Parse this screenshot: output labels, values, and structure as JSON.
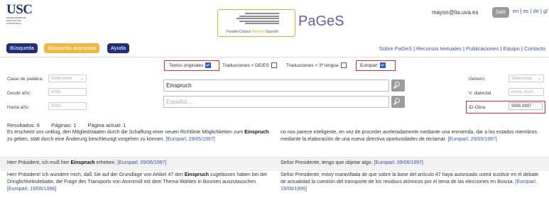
{
  "header": {
    "usc_logo": "USC",
    "usc_logo_sub": "UNIVERSIDADE DE SANTIAGO DE COMPOSTELA",
    "pages_logo": "PaGeS",
    "pages_tagline_1": "Parallel Corpus ",
    "pages_tagline_2": "German",
    "pages_tagline_3": " Spanish",
    "user_email": "maysn@lia.uva.es",
    "logout": "Salir",
    "languages": [
      "en",
      "es",
      "de",
      "gl"
    ]
  },
  "nav": {
    "busqueda": "Búsqueda",
    "busqueda_avanzada": "Búsqueda avanzada",
    "ayuda": "Ayuda",
    "links": [
      "Sobre PaGeS",
      "Recursos textuales",
      "Publicaciones",
      "Equipo",
      "Contacto"
    ]
  },
  "filters": {
    "textos_originales": "Textos originales",
    "traducciones_de_es": "Traducciones < DE/ES",
    "traducciones_3": "Traducciones < 3ª lengua",
    "europarl": "Europarl"
  },
  "form": {
    "clase_palabra_label": "Clase de palabra:",
    "clase_palabra_value": "Seleccione",
    "desde_label": "Desde año:",
    "desde_value": "0000",
    "hasta_label": "Hasta año:",
    "hasta_value": "0000",
    "german_query": "Einspruch",
    "spanish_placeholder": "Español ...",
    "genero_label": "Género:",
    "genero_value": "Seleccione",
    "v_dialectal_label": "V. dialectal",
    "v_dialectal_value": "esme, dsch",
    "id_obra_label": "ID-Obra",
    "id_obra_value": "9996,9997"
  },
  "results": {
    "resultados": "Resultados: 6",
    "paginas": "Páginas: 1",
    "pagina_actual": "Página actual: 1"
  },
  "rows": [
    {
      "de_pre": "Es erscheint uns unklug, den Mitgliedstaaten durch die Schaffung einer neuen Richtlinie Möglichkeiten zum ",
      "de_kw": "Einspruch",
      "de_post": " zu geben, statt durch eine Änderung beschleunigt vorgehen zu können. ",
      "de_ref": "[Europarl, 29/05/1997]",
      "es_text": "no nos parece inteligente, en vez de proceder aceleradamente mediante una enmienda, dar a los estados miembros mediante la elaboración de una nueva directiva oportunidades de reclamar. ",
      "es_ref": "[Europarl, 29/05/1997]"
    },
    {
      "de_pre": "Herr Präsident, ich muß hier ",
      "de_kw": "Einspruch",
      "de_post": " erheben. ",
      "de_ref": "[Europarl, 09/06/1997]",
      "es_text": "Señor Presidente, tengo que objetar algo. ",
      "es_ref": "[Europarl, 09/06/1997]"
    },
    {
      "de_pre": "Herr Präsident! Ich wundere mich, daß Sie auf der Grundlage von Artikel 47 den ",
      "de_kw": "Einspruch",
      "de_post": " zugelassen haben bei der Dringlichkeitsdebatte, die Frage des Transports von Atommüll mit dem Thema Wahlen in Bosnien auszutauschen. ",
      "de_ref": "[Europarl, 19/06/1996]",
      "es_text": "Señor Presidente, estoy maravillada de que sobre la base del artículo 47 haya autorizado usted sustituir en el debate de actualidad la cuestión del transporte de los residuos atómicos por el tema de las elecciones en Bosnia. ",
      "es_ref": "[Europarl, 19/06/1996]"
    }
  ]
}
